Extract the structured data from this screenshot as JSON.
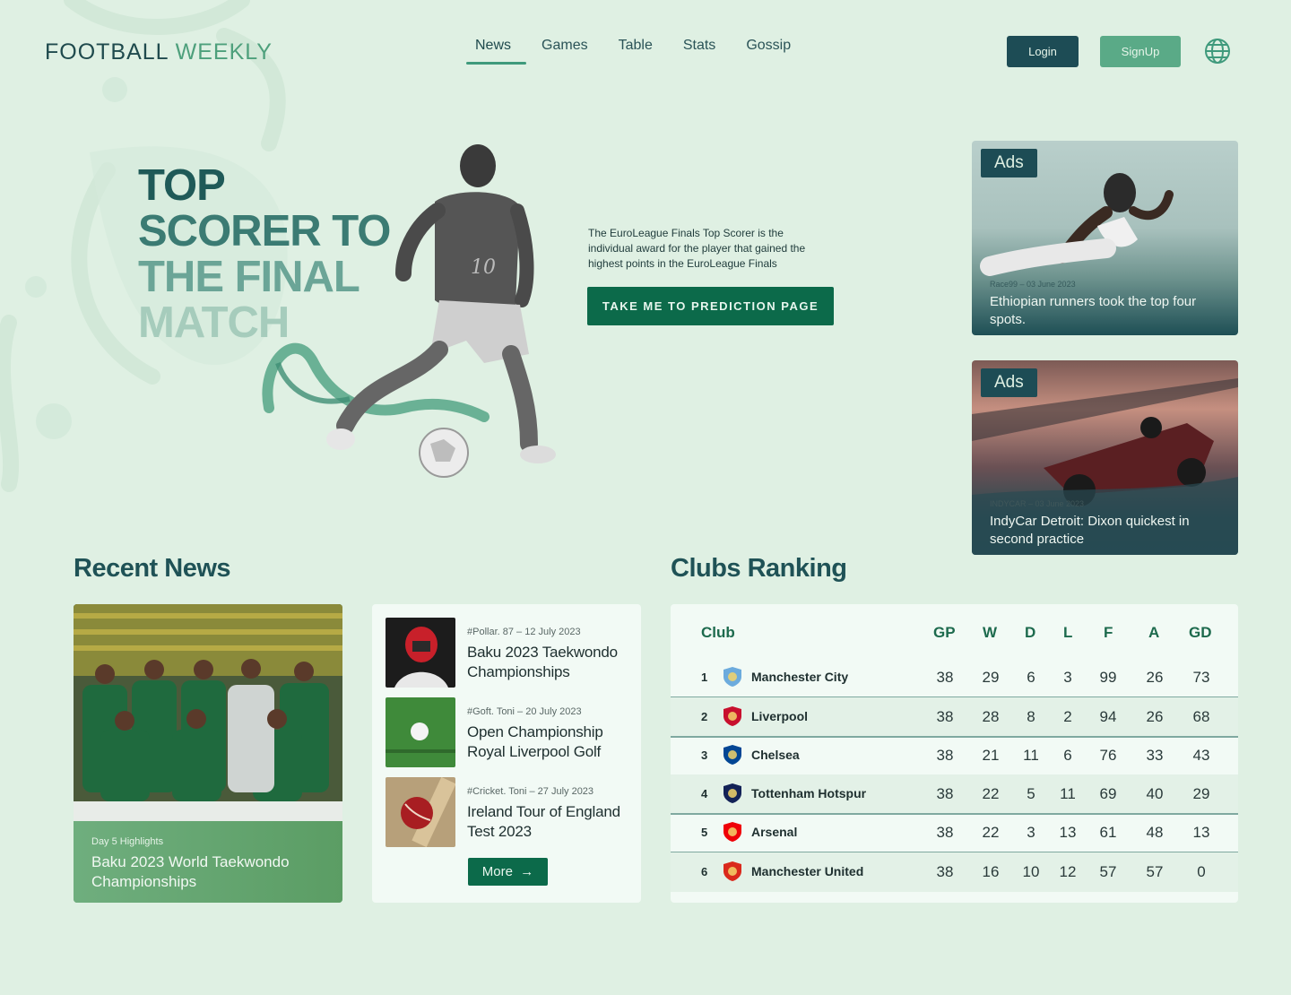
{
  "brand": {
    "part1": "FOOTBALL",
    "part2": "WEEKLY"
  },
  "nav": {
    "items": [
      "News",
      "Games",
      "Table",
      "Stats",
      "Gossip"
    ],
    "active": "News"
  },
  "auth": {
    "login": "Login",
    "signup": "SignUp"
  },
  "hero": {
    "title_lines": [
      "TOP",
      "SCORER TO",
      "THE FINAL",
      "MATCH"
    ],
    "description": "The EuroLeague Finals Top Scorer is the individual award for the player that gained the highest points in the EuroLeague Finals",
    "cta": "TAKE ME TO PREDICTION PAGE",
    "jersey_number": "10"
  },
  "ads": [
    {
      "badge": "Ads",
      "meta": "Race99 – 03 June 2023",
      "title": "Ethiopian runners took the top four spots."
    },
    {
      "badge": "Ads",
      "meta": "INDYCAR – 03 June 2023",
      "title": "IndyCar Detroit: Dixon quickest in second practice"
    }
  ],
  "recent_news": {
    "heading": "Recent News",
    "feature": {
      "meta": "Day 5 Highlights",
      "title": "Baku 2023 World Taekwondo Championships"
    },
    "items": [
      {
        "meta": "#Pollar. 87 – 12 July 2023",
        "title": "Baku 2023 Taekwondo Championships",
        "thumb": "taekwondo-icon"
      },
      {
        "meta": "#Goft. Toni – 20 July 2023",
        "title": "Open Championship Royal Liverpool Golf",
        "thumb": "golf-icon"
      },
      {
        "meta": "#Cricket. Toni – 27 July 2023",
        "title": "Ireland Tour of England Test 2023",
        "thumb": "cricket-icon"
      }
    ],
    "more": "More"
  },
  "clubs_ranking": {
    "heading": "Clubs Ranking",
    "columns": [
      "Club",
      "GP",
      "W",
      "D",
      "L",
      "F",
      "A",
      "GD"
    ],
    "rows": [
      {
        "rank": "1",
        "club": "Manchester City",
        "gp": "38",
        "w": "29",
        "d": "6",
        "l": "3",
        "f": "99",
        "a": "26",
        "gd": "73",
        "crest": "#6cabdd"
      },
      {
        "rank": "2",
        "club": "Liverpool",
        "gp": "38",
        "w": "28",
        "d": "8",
        "l": "2",
        "f": "94",
        "a": "26",
        "gd": "68",
        "crest": "#c8102e"
      },
      {
        "rank": "3",
        "club": "Chelsea",
        "gp": "38",
        "w": "21",
        "d": "11",
        "l": "6",
        "f": "76",
        "a": "33",
        "gd": "43",
        "crest": "#034694"
      },
      {
        "rank": "4",
        "club": "Tottenham Hotspur",
        "gp": "38",
        "w": "22",
        "d": "5",
        "l": "11",
        "f": "69",
        "a": "40",
        "gd": "29",
        "crest": "#132257"
      },
      {
        "rank": "5",
        "club": "Arsenal",
        "gp": "38",
        "w": "22",
        "d": "3",
        "l": "13",
        "f": "61",
        "a": "48",
        "gd": "13",
        "crest": "#ef0107"
      },
      {
        "rank": "6",
        "club": "Manchester United",
        "gp": "38",
        "w": "16",
        "d": "10",
        "l": "12",
        "f": "57",
        "a": "57",
        "gd": "0",
        "crest": "#da291c"
      }
    ]
  },
  "colors": {
    "background": "#dff0e3",
    "primary_dark": "#1d4c55",
    "accent_green": "#0c6a4a",
    "soft_green": "#5aaa87"
  }
}
